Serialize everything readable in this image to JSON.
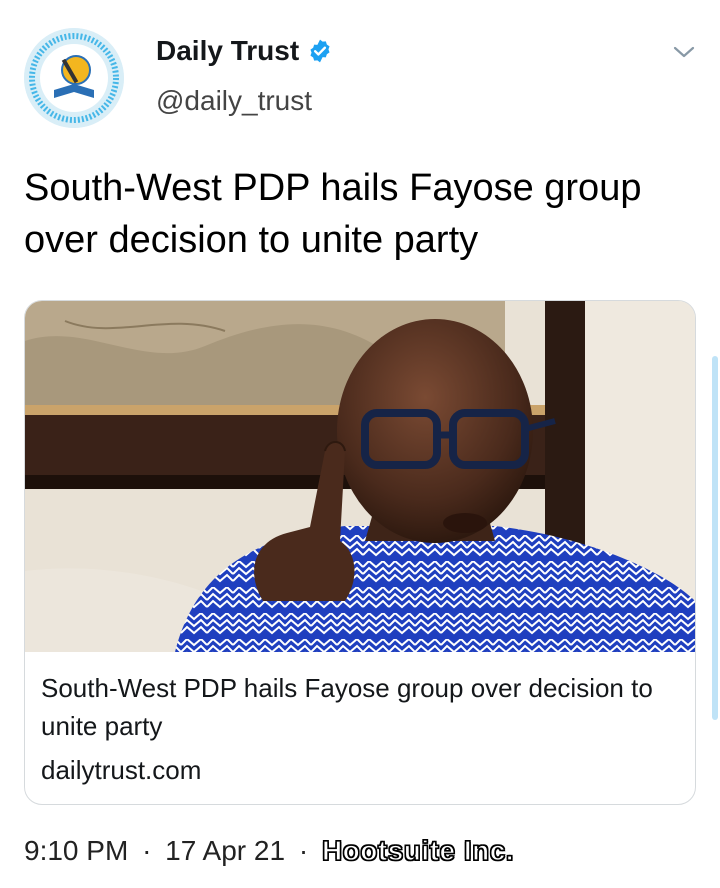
{
  "tweet": {
    "author": {
      "display_name": "Daily Trust",
      "handle": "@daily_trust",
      "verified": true,
      "avatar_icon": "daily-trust-logo"
    },
    "text": "South-West PDP hails Fayose group over decision to unite party",
    "menu_icon": "chevron-down-icon",
    "link_card": {
      "image_alt": "man in blue patterned agbada gesturing",
      "title": "South-West PDP hails Fayose group over decision to unite party",
      "domain": "dailytrust.com"
    },
    "meta": {
      "time": "9:10 PM",
      "separator": "·",
      "date": "17 Apr 21",
      "source": "Hootsuite Inc."
    }
  },
  "colors": {
    "verified_blue": "#1da1f2",
    "text": "#14171a",
    "card_border": "#d6dadd",
    "shirt_blue": "#1f3fbf"
  }
}
